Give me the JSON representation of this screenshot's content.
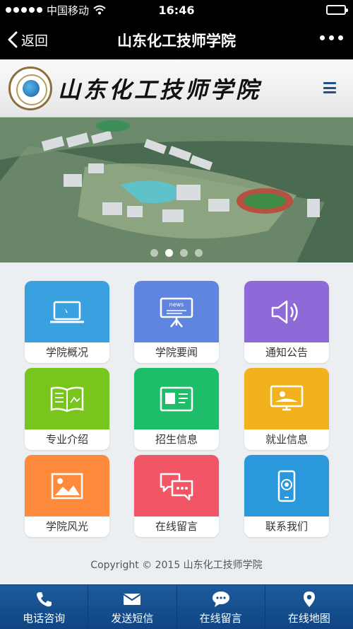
{
  "status_bar": {
    "carrier": "中国移动",
    "time": "16:46"
  },
  "nav": {
    "back_label": "返回",
    "title": "山东化工技师学院"
  },
  "header": {
    "logo_text": "山东化工技师学院"
  },
  "banner": {
    "page_count": 4,
    "active_index": 1
  },
  "tiles": [
    {
      "label": "学院概况",
      "icon": "laptop-icon",
      "color": "#3aa1e0"
    },
    {
      "label": "学院要闻",
      "icon": "news-board-icon",
      "color": "#5f85e0"
    },
    {
      "label": "通知公告",
      "icon": "speaker-icon",
      "color": "#8d6ad8"
    },
    {
      "label": "专业介绍",
      "icon": "open-book-icon",
      "color": "#77c51d"
    },
    {
      "label": "招生信息",
      "icon": "id-card-icon",
      "color": "#1ebd6a"
    },
    {
      "label": "就业信息",
      "icon": "monitor-sun-icon",
      "color": "#f2b21d"
    },
    {
      "label": "学院风光",
      "icon": "picture-icon",
      "color": "#ff8a3c"
    },
    {
      "label": "在线留言",
      "icon": "chat-bubbles-icon",
      "color": "#f25566"
    },
    {
      "label": "联系我们",
      "icon": "mobile-phone-icon",
      "color": "#2b98dc"
    }
  ],
  "footer": {
    "copyright": "Copyright © 2015 山东化工技师学院"
  },
  "tabbar": [
    {
      "label": "电话咨询",
      "icon": "phone-icon"
    },
    {
      "label": "发送短信",
      "icon": "envelope-icon"
    },
    {
      "label": "在线留言",
      "icon": "chat-icon"
    },
    {
      "label": "在线地图",
      "icon": "map-pin-icon"
    }
  ]
}
